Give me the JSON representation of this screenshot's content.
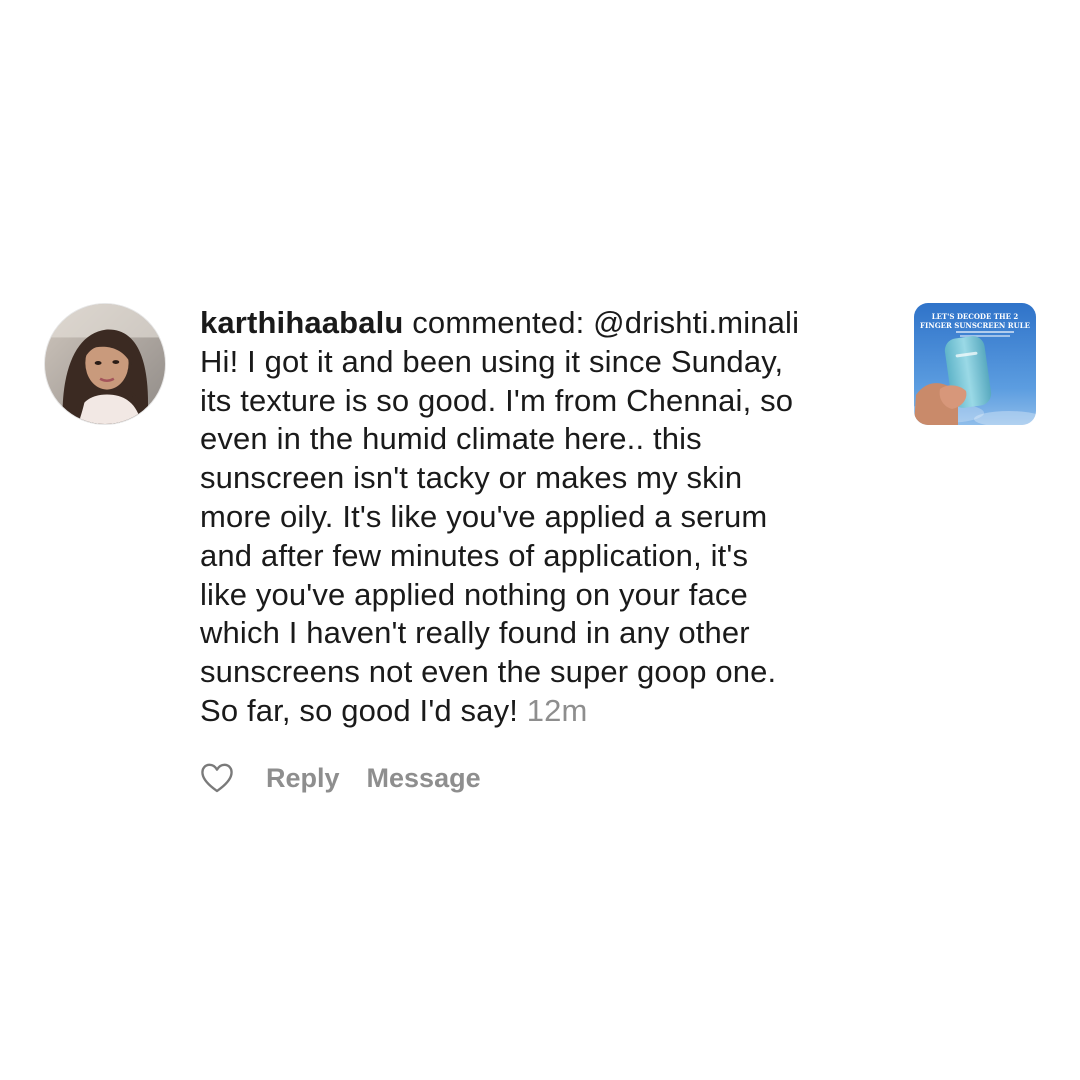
{
  "notification": {
    "username": "karthihaabalu",
    "action": " commented: ",
    "mention": "@drishti.minali",
    "body": "Hi! I got it and been using it since Sunday,\nits texture is so good. I'm from Chennai, so\neven in the humid climate here.. this\nsunscreen isn't tacky or makes my skin\nmore oily. It's like you've applied a serum\nand after few minutes of application, it's\nlike you've applied nothing on your face\nwhich I haven't really found in any other\nsunscreens not even the super goop one.\nSo far, so good I'd say! ",
    "time": "12m"
  },
  "post_thumbnail": {
    "headline_line1": "LET'S DECODE THE 2",
    "headline_line2": "FINGER SUNSCREEN RULE"
  },
  "actions": {
    "like_icon": "heart-outline-icon",
    "reply_label": "Reply",
    "message_label": "Message"
  },
  "colors": {
    "text": "#1a1a1a",
    "secondary": "#8e8e8e",
    "background": "#ffffff",
    "sky": "#3f86d6",
    "bottle": "#7cc7d8"
  }
}
